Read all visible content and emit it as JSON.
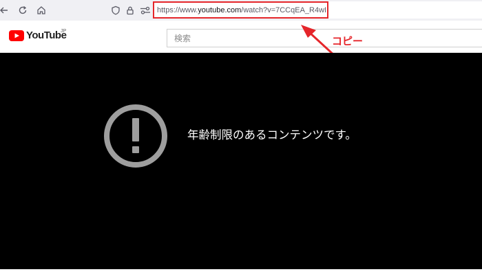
{
  "browser": {
    "url_prefix": "https://www.",
    "url_host": "youtube.com",
    "url_path": "/watch?v=7CCqEA_R4wI",
    "icons": [
      "back-arrow-icon",
      "reload-icon",
      "home-icon",
      "shield-icon",
      "lock-icon",
      "permissions-icon"
    ]
  },
  "header": {
    "logo_text": "YouTube",
    "region": "JP",
    "search_placeholder": "検索"
  },
  "annotation": {
    "label": "コピー",
    "color": "#e5252a"
  },
  "player": {
    "message": "年齢制限のあるコンテンツです。",
    "icon": "alert-circle-icon"
  },
  "colors": {
    "brand_red": "#ff0000",
    "player_bg": "#000000",
    "icon_gray": "#9e9e9e"
  }
}
